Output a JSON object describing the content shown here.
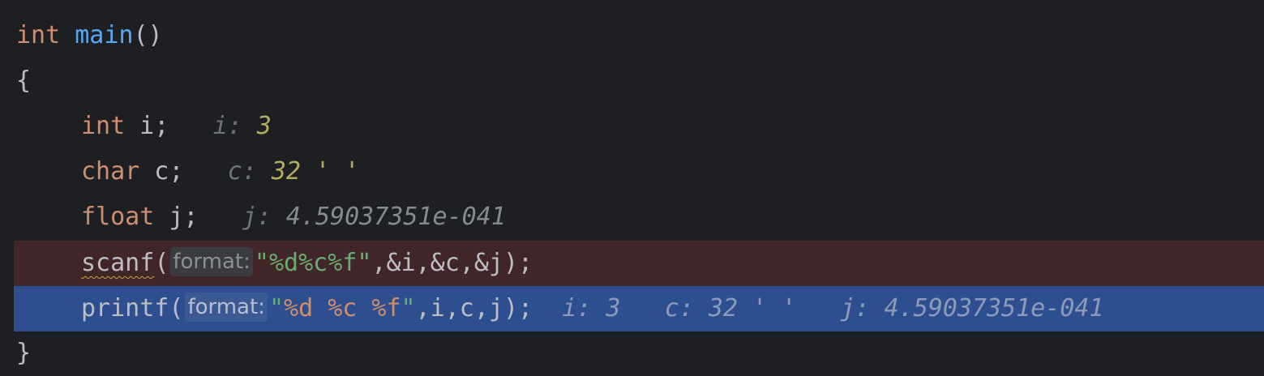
{
  "code": {
    "line1": {
      "kw": "int",
      "fn": "main",
      "rest": "()"
    },
    "line2": {
      "brace": "{"
    },
    "line3": {
      "kw": "int",
      "code": " i;",
      "hint_name": "i:",
      "hint_val": "3"
    },
    "line4": {
      "kw": "char",
      "code": " c;",
      "hint_name": "c:",
      "hint_val": "32 ' '"
    },
    "line5": {
      "kw": "float",
      "code": " j;",
      "hint_name": "j:",
      "hint_val": "4.59037351e-041"
    },
    "line6": {
      "fn": "scanf",
      "open": "(",
      "param_hint": "format:",
      "str_open": "\"",
      "str_body": "%d%c%f",
      "str_close": "\"",
      "args": ",&i,&c,&j);"
    },
    "line7": {
      "fn": "printf",
      "open": "(",
      "param_hint": "format:",
      "str_open": "\"",
      "fmt1": "%d",
      "sp1": " ",
      "fmt2": "%c",
      "sp2": " ",
      "fmt3": "%f",
      "str_close": "\"",
      "args": ",i,c,j);",
      "inline_values": "i: 3   c: 32 ' '   j: 4.59037351e-041"
    },
    "line8": {
      "brace": "}"
    }
  },
  "colors": {
    "background": "#1e1f22",
    "breakpoint_line": "#402529",
    "execution_line": "#2d4f8f",
    "keyword": "#cf8e6d",
    "function": "#56a8f5",
    "string": "#6aab73"
  }
}
